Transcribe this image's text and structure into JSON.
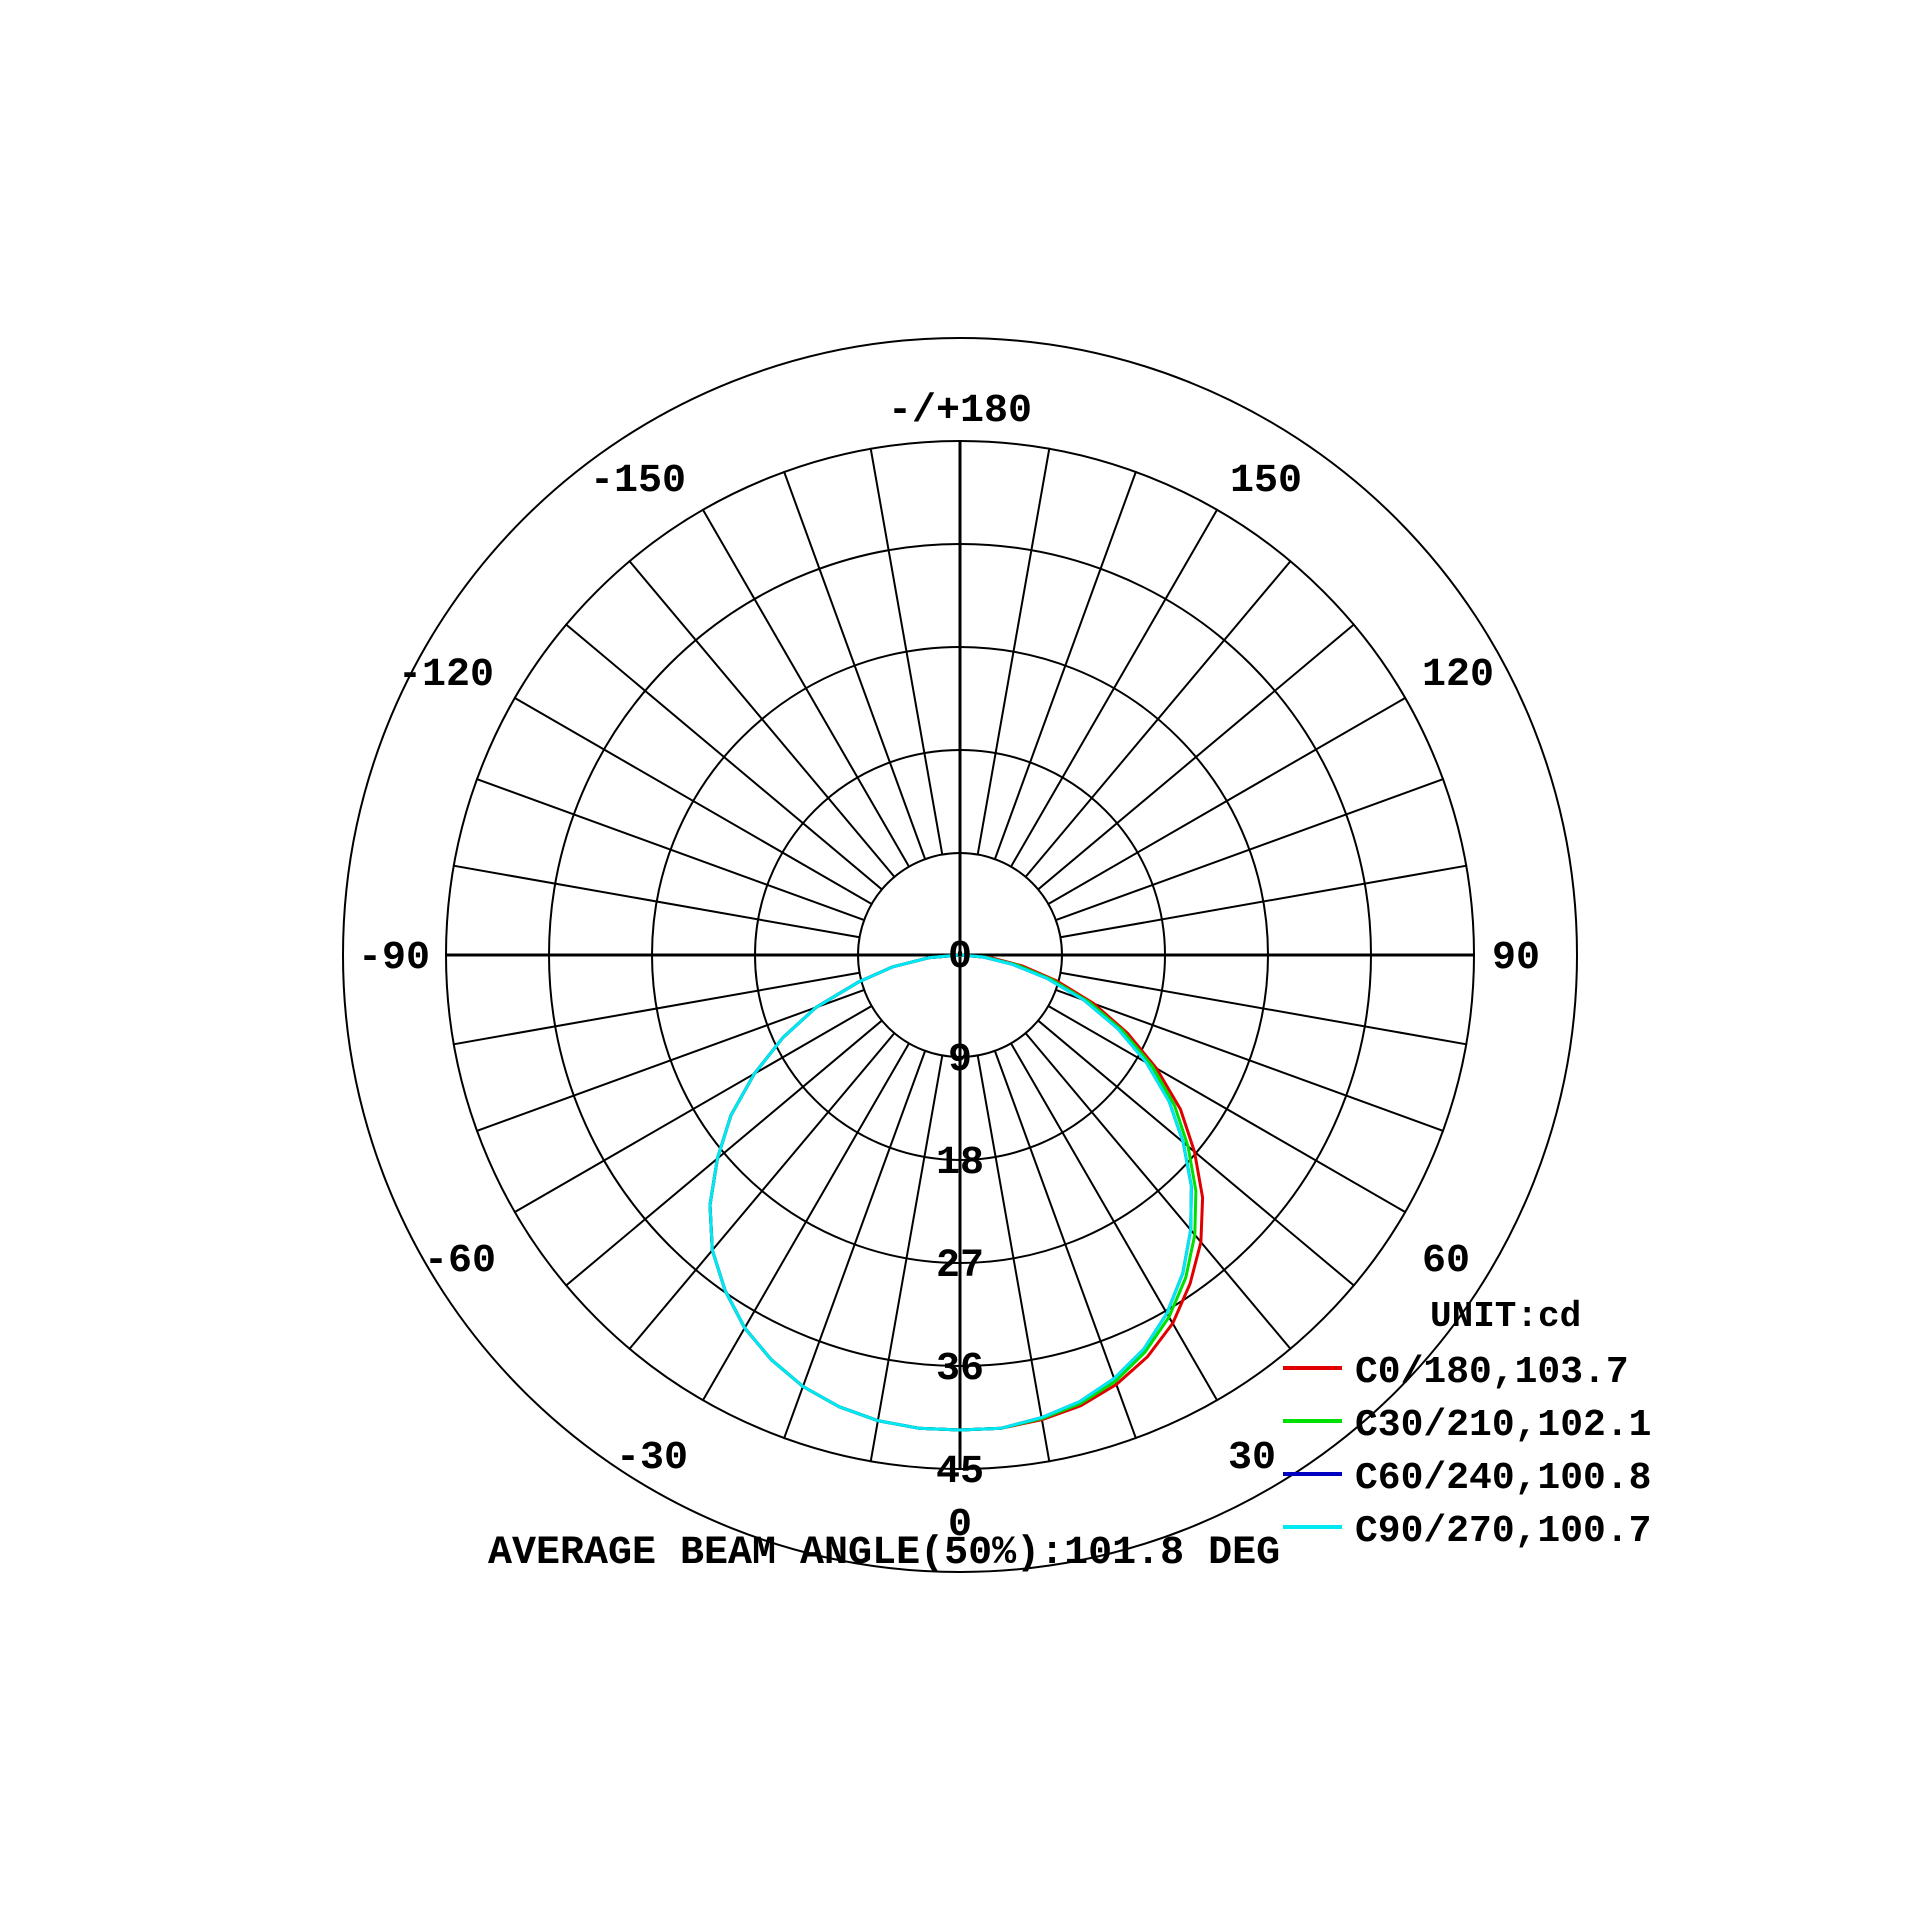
{
  "chart_data": {
    "type": "polar",
    "angle_labels": [
      "0",
      "30",
      "60",
      "90",
      "120",
      "150",
      "-/+180",
      "-150",
      "-120",
      "-90",
      "-60",
      "-30"
    ],
    "radial_axis": {
      "ticks": [
        "0",
        "9",
        "18",
        "27",
        "36",
        "45"
      ],
      "range": [
        0,
        45
      ]
    },
    "unit": "UNIT:cd",
    "series": [
      {
        "name": "C0/180,103.7",
        "color": "#e00000",
        "angles": [
          0,
          5,
          10,
          15,
          20,
          25,
          30,
          35,
          40,
          45,
          50,
          55,
          60,
          65,
          70,
          75,
          80,
          85,
          90
        ],
        "right": [
          45.0,
          45.0,
          44.7,
          44.2,
          43.3,
          42.0,
          40.3,
          38.0,
          35.5,
          32.5,
          29.0,
          25.5,
          21.5,
          17.5,
          13.5,
          9.5,
          6.0,
          3.0,
          0.5
        ],
        "left": [
          45.0,
          45.0,
          44.8,
          44.3,
          43.5,
          42.3,
          40.8,
          38.8,
          36.5,
          33.5,
          30.0,
          26.5,
          22.5,
          18.5,
          14.5,
          10.0,
          6.5,
          3.0,
          0.5
        ]
      },
      {
        "name": "C30/210,102.1",
        "color": "#00e000",
        "angles": [
          0,
          5,
          10,
          15,
          20,
          25,
          30,
          35,
          40,
          45,
          50,
          55,
          60,
          65,
          70,
          75,
          80,
          85,
          90
        ],
        "right": [
          45.0,
          45.0,
          44.6,
          44.0,
          43.0,
          41.5,
          39.6,
          37.3,
          34.6,
          31.6,
          28.2,
          24.8,
          21.0,
          17.0,
          13.0,
          9.0,
          5.5,
          2.5,
          0.4
        ],
        "left": [
          45.0,
          45.0,
          44.8,
          44.3,
          43.5,
          42.3,
          40.8,
          38.8,
          36.5,
          33.5,
          30.0,
          26.5,
          22.5,
          18.5,
          14.5,
          10.0,
          6.5,
          3.0,
          0.5
        ]
      },
      {
        "name": "C60/240,100.8",
        "color": "#0000c0",
        "angles": [
          0,
          5,
          10,
          15,
          20,
          25,
          30,
          35,
          40,
          45,
          50,
          55,
          60,
          65,
          70,
          75,
          80,
          85,
          90
        ],
        "right": [
          45.0,
          45.0,
          44.5,
          43.8,
          42.7,
          41.2,
          39.2,
          36.8,
          34.0,
          31.0,
          27.6,
          24.2,
          20.4,
          16.5,
          12.5,
          8.5,
          5.0,
          2.2,
          0.3
        ],
        "left": [
          45.0,
          45.0,
          44.8,
          44.3,
          43.5,
          42.3,
          40.8,
          38.8,
          36.5,
          33.5,
          30.0,
          26.5,
          22.5,
          18.5,
          14.5,
          10.0,
          6.5,
          3.0,
          0.5
        ]
      },
      {
        "name": "C90/270,100.7",
        "color": "#00e8f0",
        "angles": [
          0,
          5,
          10,
          15,
          20,
          25,
          30,
          35,
          40,
          45,
          50,
          55,
          60,
          65,
          70,
          75,
          80,
          85,
          90
        ],
        "right": [
          45.0,
          45.0,
          44.5,
          43.8,
          42.7,
          41.2,
          39.2,
          36.8,
          34.0,
          31.0,
          27.6,
          24.2,
          20.4,
          16.5,
          12.5,
          8.5,
          5.0,
          2.2,
          0.3
        ],
        "left": [
          45.0,
          45.0,
          44.8,
          44.3,
          43.5,
          42.3,
          40.8,
          38.8,
          36.5,
          33.5,
          30.0,
          26.5,
          22.5,
          18.5,
          14.5,
          10.0,
          6.5,
          3.0,
          0.5
        ]
      }
    ],
    "annotation": "AVERAGE BEAM ANGLE(50%):101.8 DEG",
    "legend_position": "bottom-right",
    "grid": true
  }
}
